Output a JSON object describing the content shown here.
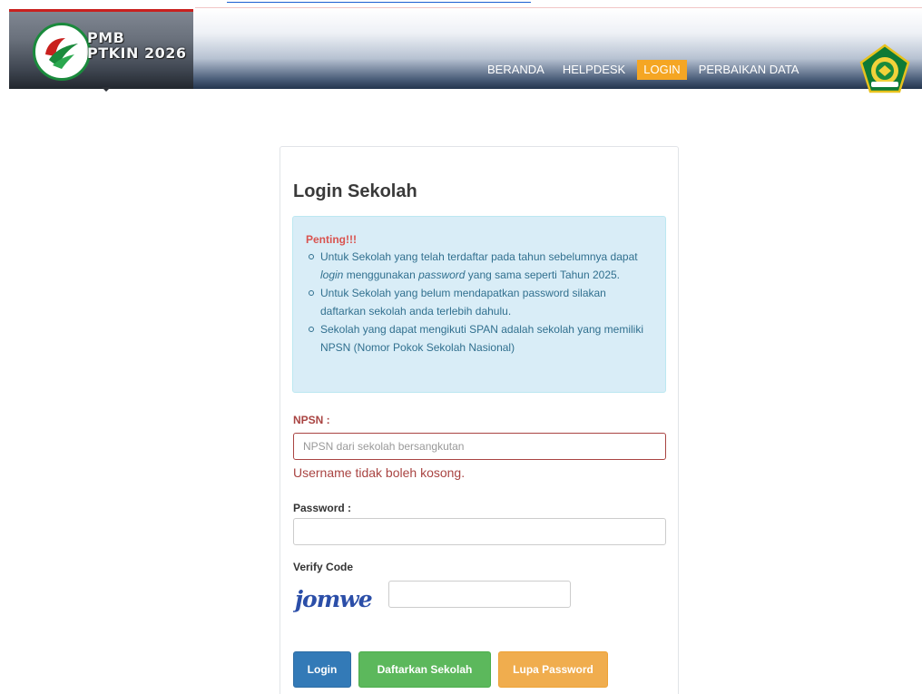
{
  "header": {
    "brand_line1": "PMB",
    "brand_line2": "PTKIN 2026",
    "nav": [
      {
        "label": "BERANDA",
        "active": false
      },
      {
        "label": "HELPDESK",
        "active": false
      },
      {
        "label": "LOGIN",
        "active": true
      },
      {
        "label": "PERBAIKAN DATA",
        "active": false
      }
    ],
    "logo_icon": "pmb-ptkin-logo-icon",
    "emblem_icon": "kemenag-emblem-icon"
  },
  "login": {
    "title": "Login Sekolah",
    "alert": {
      "title": "Penting!!!",
      "item1_a": "Untuk Sekolah yang telah terdaftar pada tahun sebelumnya dapat ",
      "item1_login": "login",
      "item1_b": " menggunakan ",
      "item1_password": "password",
      "item1_c": " yang sama seperti Tahun 2025.",
      "item2": "Untuk Sekolah yang belum mendapatkan password silakan daftarkan sekolah anda terlebih dahulu.",
      "item3": "Sekolah yang dapat mengikuti SPAN adalah sekolah yang memiliki NPSN (Nomor Pokok Sekolah Nasional)"
    },
    "npsn_label": "NPSN :",
    "npsn_placeholder": "NPSN dari sekolah bersangkutan",
    "npsn_value": "",
    "npsn_error": "Username tidak boleh kosong.",
    "password_label": "Password :",
    "password_value": "",
    "verify_label": "Verify Code",
    "captcha_text": "jomwe",
    "verify_value": "",
    "buttons": {
      "login": "Login",
      "daftar": "Daftarkan Sekolah",
      "lupa": "Lupa Password"
    }
  },
  "colors": {
    "nav_active": "#f5a623",
    "primary": "#337ab7",
    "success": "#5cb85c",
    "warning": "#f0ad4e",
    "error": "#a94442",
    "info_bg": "#d9edf7"
  }
}
